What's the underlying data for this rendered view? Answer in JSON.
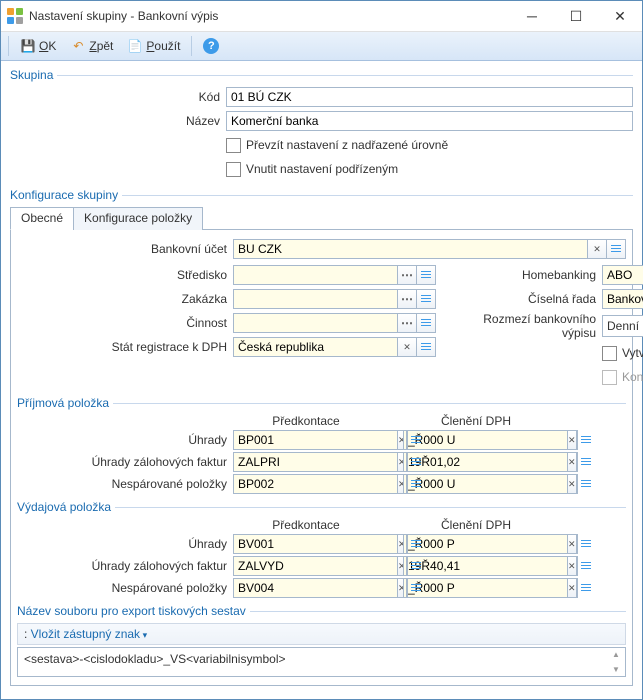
{
  "window": {
    "title": "Nastavení skupiny - Bankovní výpis"
  },
  "toolbar": {
    "ok": "OK",
    "zpet": "Zpět",
    "pouzit": "Použít"
  },
  "grp_skupina": {
    "title": "Skupina",
    "kod_lbl": "Kód",
    "kod": "01 BÚ CZK",
    "nazev_lbl": "Název",
    "nazev": "Komerční banka",
    "chk1": "Převzít nastavení z nadřazené úrovně",
    "chk2": "Vnutit nastavení podřízeným"
  },
  "grp_konf": {
    "title": "Konfigurace skupiny",
    "tab1": "Obecné",
    "tab2": "Konfigurace položky"
  },
  "obecne": {
    "bu_lbl": "Bankovní účet",
    "bu": "BU CZK",
    "str_lbl": "Středisko",
    "str": "",
    "zak_lbl": "Zakázka",
    "zak": "",
    "cin_lbl": "Činnost",
    "cin": "",
    "stat_lbl": "Stát registrace k DPH",
    "stat": "Česká republika",
    "hb_lbl": "Homebanking",
    "hb": "ABO",
    "cr_lbl": "Číselná řada",
    "cr": "Bankovní výpisy",
    "roz_lbl": "Rozmezí bankovního výpisu",
    "roz": "Denní",
    "chk_konc": "Vytvářet koncepty",
    "chk_konc_bez": "Koncepty bez čísla"
  },
  "prijmova": {
    "title": "Příjmová položka",
    "h1": "Předkontace",
    "h2": "Členění DPH",
    "uhr_lbl": "Úhrady",
    "uhr_pk": "BP001",
    "uhr_dph": "_Ř000 U",
    "zal_lbl": "Úhrady zálohových faktur",
    "zal_pk": "ZALPRI",
    "zal_dph": "19Ř01,02",
    "nes_lbl": "Nespárované položky",
    "nes_pk": "BP002",
    "nes_dph": "_Ř000 U"
  },
  "vydajova": {
    "title": "Výdajová položka",
    "h1": "Předkontace",
    "h2": "Členění DPH",
    "uhr_lbl": "Úhrady",
    "uhr_pk": "BV001",
    "uhr_dph": "_Ř000 P",
    "zal_lbl": "Úhrady zálohových faktur",
    "zal_pk": "ZALVYD",
    "zal_dph": "19Ř40,41",
    "nes_lbl": "Nespárované položky",
    "nes_pk": "BV004",
    "nes_dph": "_Ř000 P"
  },
  "export": {
    "title": "Název souboru pro export tiskových sestav",
    "insert": "Vložit zástupný znak",
    "expr": "<sestava>-<cislodokladu>_VS<variabilnisymbol>"
  }
}
